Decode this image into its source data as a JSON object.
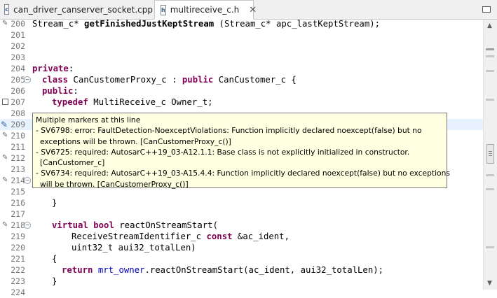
{
  "tabs": [
    {
      "label": "can_driver_canserver_socket.cpp",
      "icon": "cpp-source-file-icon",
      "active": false
    },
    {
      "label": "multireceive_c.h",
      "icon": "header-file-icon",
      "active": true,
      "close": "✕"
    }
  ],
  "lines": [
    {
      "num": "200",
      "marker": "pencil",
      "text": "Stream_c* getFinishedJustKeptStream (Stream_c* apc_lastKeptStream);"
    },
    {
      "num": "201",
      "text": ""
    },
    {
      "num": "202",
      "text": ""
    },
    {
      "num": "203",
      "text": ""
    },
    {
      "num": "204",
      "text": "private:"
    },
    {
      "num": "205",
      "fold": "⊖",
      "text": "class CanCustomerProxy_c : public CanCustomer_c {"
    },
    {
      "num": "206",
      "text": "public:"
    },
    {
      "num": "207",
      "marker": "rect",
      "text": "typedef MultiReceive_c Owner_t;"
    },
    {
      "num": "208",
      "text": ""
    },
    {
      "num": "209",
      "marker": "warning",
      "text": ""
    },
    {
      "num": "210",
      "marker": "pencil",
      "text": ""
    },
    {
      "num": "211",
      "text": ""
    },
    {
      "num": "212",
      "marker": "pencil",
      "text": ""
    },
    {
      "num": "213",
      "text": ""
    },
    {
      "num": "214",
      "marker": "pencil",
      "fold": "⊖",
      "text": ""
    },
    {
      "num": "215",
      "text": ""
    },
    {
      "num": "216",
      "text": "}"
    },
    {
      "num": "217",
      "text": ""
    },
    {
      "num": "218",
      "marker": "pencil",
      "fold": "⊖",
      "text": "virtual bool reactOnStreamStart("
    },
    {
      "num": "219",
      "text": "ReceiveStreamIdentifier_c const &ac_ident,"
    },
    {
      "num": "220",
      "text": "uint32_t aui32_totalLen)"
    },
    {
      "num": "221",
      "text": "{"
    },
    {
      "num": "222",
      "text": "return mrt_owner.reactOnStreamStart(ac_ident, aui32_totalLen);"
    },
    {
      "num": "223",
      "text": "}"
    },
    {
      "num": "224",
      "text": ""
    }
  ],
  "tooltip": {
    "lines": [
      "Multiple markers at this line",
      "- SV6798: error: FaultDetection-NoexceptViolations: Function implicitly declared noexcept(false) but no",
      "exceptions will be thrown. [CanCustomerProxy_c()]",
      "- SV6725: required: AutosarC++19_03-A12.1.1: Base class is not explicitly initialized in constructor.",
      "[CanCustomer_c]",
      "- SV6734: required: AutosarC++19_03-A15.4.4: Function implicitly declared noexcept(false) but no exceptions",
      "will be thrown. [CanCustomerProxy_c()]"
    ]
  },
  "scrollbar": {
    "up_arrow": "▲",
    "down_arrow": "▼",
    "marks": [
      {
        "color": "#a0a0a0",
        "frac": 0.06
      },
      {
        "color": "#c8c8c8",
        "frac": 0.09
      },
      {
        "color": "#c8c8c8",
        "frac": 0.15
      },
      {
        "color": "#c8c8c8",
        "frac": 0.27
      },
      {
        "color": "#c8c8c8",
        "frac": 0.58
      },
      {
        "color": "#c8c8c8",
        "frac": 0.64
      },
      {
        "color": "#c8c8c8",
        "frac": 0.88
      }
    ]
  },
  "colors": {
    "keyword": "#7f0055",
    "field": "#0000c0",
    "tooltip_bg": "#ffffe1",
    "current_line": "#e8f2fe"
  }
}
